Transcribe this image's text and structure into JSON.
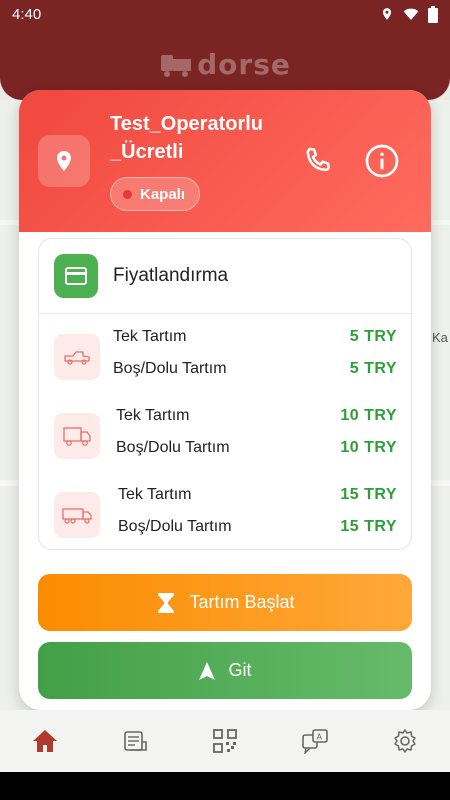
{
  "status_bar": {
    "time": "4:40"
  },
  "header": {
    "logo_text": "dorse"
  },
  "map": {
    "label_right": "Ka"
  },
  "station": {
    "name_line1": "Test_Operatorlu",
    "name_line2": "_Ücretli",
    "status": "Kapalı",
    "status_color": "#e53935"
  },
  "pricing": {
    "title": "Fiyatlandırma",
    "groups": [
      {
        "vehicle": "pickup-truck-icon",
        "rows": [
          {
            "label": "Tek Tartım",
            "price": "5 TRY"
          },
          {
            "label": "Boş/Dolu Tartım",
            "price": "5 TRY"
          }
        ]
      },
      {
        "vehicle": "truck-icon",
        "rows": [
          {
            "label": "Tek Tartım",
            "price": "10 TRY"
          },
          {
            "label": "Boş/Dolu Tartım",
            "price": "10 TRY"
          }
        ]
      },
      {
        "vehicle": "trailer-truck-icon",
        "rows": [
          {
            "label": "Tek Tartım",
            "price": "15 TRY"
          },
          {
            "label": "Boş/Dolu Tartım",
            "price": "15 TRY"
          }
        ]
      }
    ]
  },
  "actions": {
    "start_weighing": "Tartım Başlat",
    "go": "Git"
  },
  "colors": {
    "header": "#7a2424",
    "accent_red": "#f0483e",
    "price_green": "#2e9e3a",
    "start_orange": "#fb8c00",
    "go_green": "#43a047",
    "nav_active": "#b03a2e"
  },
  "nav": [
    "home-icon",
    "receipt-icon",
    "qr-code-icon",
    "translate-icon",
    "settings-icon"
  ]
}
